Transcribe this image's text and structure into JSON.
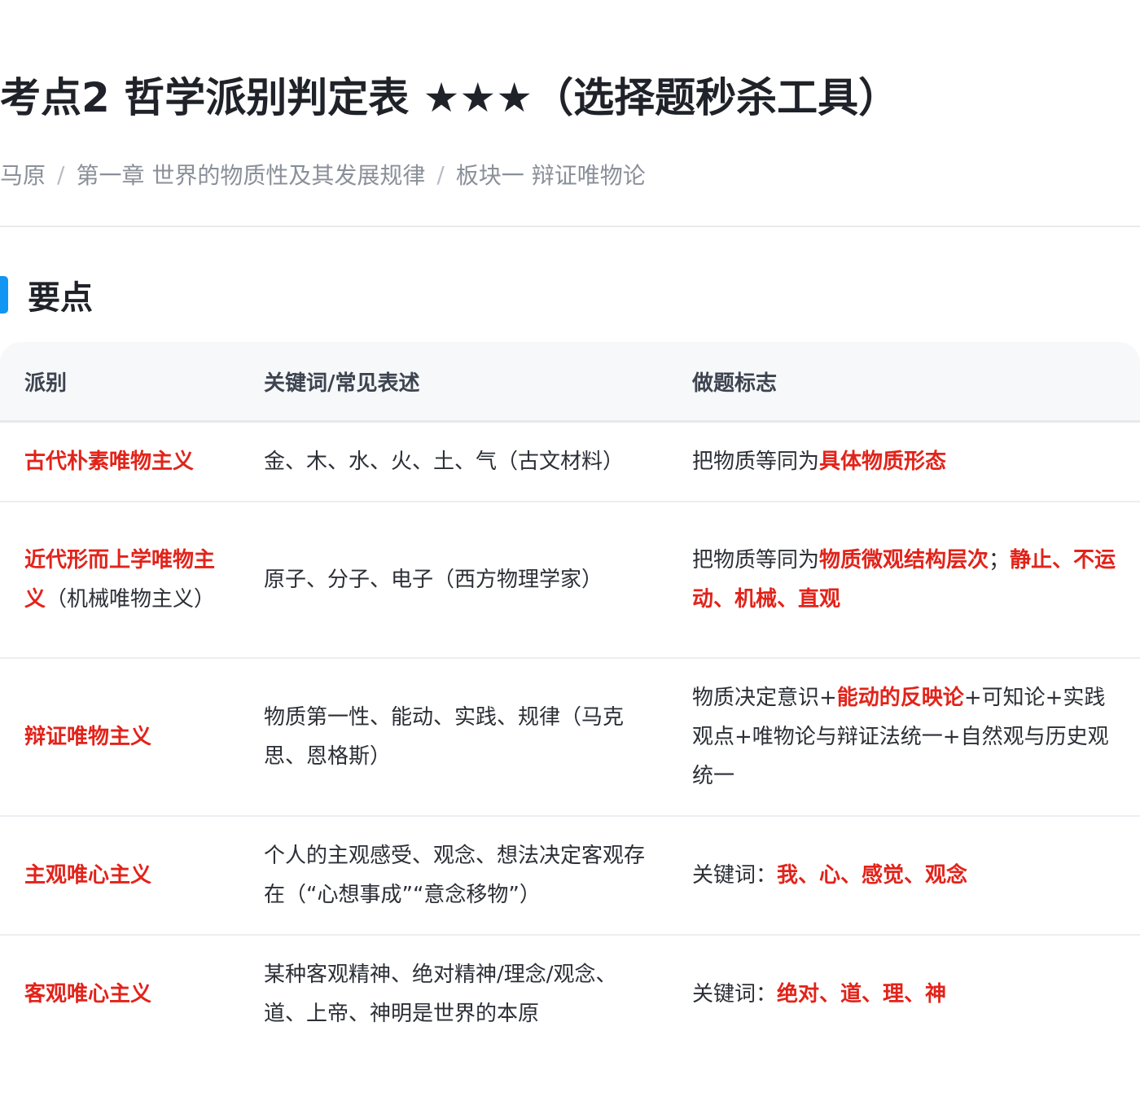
{
  "page": {
    "title": "考点2 哲学派别判定表 ★★★（选择题秒杀工具）",
    "breadcrumb": [
      "马原",
      "第一章 世界的物质性及其发展规律",
      "板块一 辩证唯物论"
    ],
    "breadcrumb_separator": "/",
    "section_title": "要点"
  },
  "table": {
    "headers": [
      "派别",
      "关键词/常见表述",
      "做题标志"
    ],
    "rows": [
      {
        "school": "古代朴素唯物主义",
        "school_note": "",
        "keywords": "金、木、水、火、土、气（古文材料）",
        "mark_prefix": "把物质等同为",
        "mark_highlight": "具体物质形态",
        "mark_mid": "",
        "mark_highlight2": "",
        "mark_suffix": ""
      },
      {
        "school": "近代形而上学唯物主义",
        "school_note": "（机械唯物主义）",
        "keywords": "原子、分子、电子（西方物理学家）",
        "mark_prefix": "把物质等同为",
        "mark_highlight": "物质微观结构层次",
        "mark_mid": "；",
        "mark_highlight2": "静止、不运动、机械、直观",
        "mark_suffix": ""
      },
      {
        "school": "辩证唯物主义",
        "school_note": "",
        "keywords": "物质第一性、能动、实践、规律（马克思、恩格斯）",
        "mark_prefix": "物质决定意识+",
        "mark_highlight": "能动的反映论",
        "mark_mid": "",
        "mark_highlight2": "",
        "mark_suffix": "+可知论+实践观点+唯物论与辩证法统一+自然观与历史观统一"
      },
      {
        "school": "主观唯心主义",
        "school_note": "",
        "keywords": "个人的主观感受、观念、想法决定客观存在（“心想事成”“意念移物”）",
        "mark_prefix": "关键词：",
        "mark_highlight": "我、心、感觉、观念",
        "mark_mid": "",
        "mark_highlight2": "",
        "mark_suffix": ""
      },
      {
        "school": "客观唯心主义",
        "school_note": "",
        "keywords": "某种客观精神、绝对精神/理念/观念、道、上帝、神明是世界的本原",
        "mark_prefix": "关键词：",
        "mark_highlight": "绝对、道、理、神",
        "mark_mid": "",
        "mark_highlight2": "",
        "mark_suffix": ""
      }
    ]
  },
  "colors": {
    "accent_bar": "#1296f3",
    "highlight_red": "#e2231a",
    "header_bg": "#f6f8fa",
    "title": "#1f2329",
    "breadcrumb": "#8a9099"
  }
}
